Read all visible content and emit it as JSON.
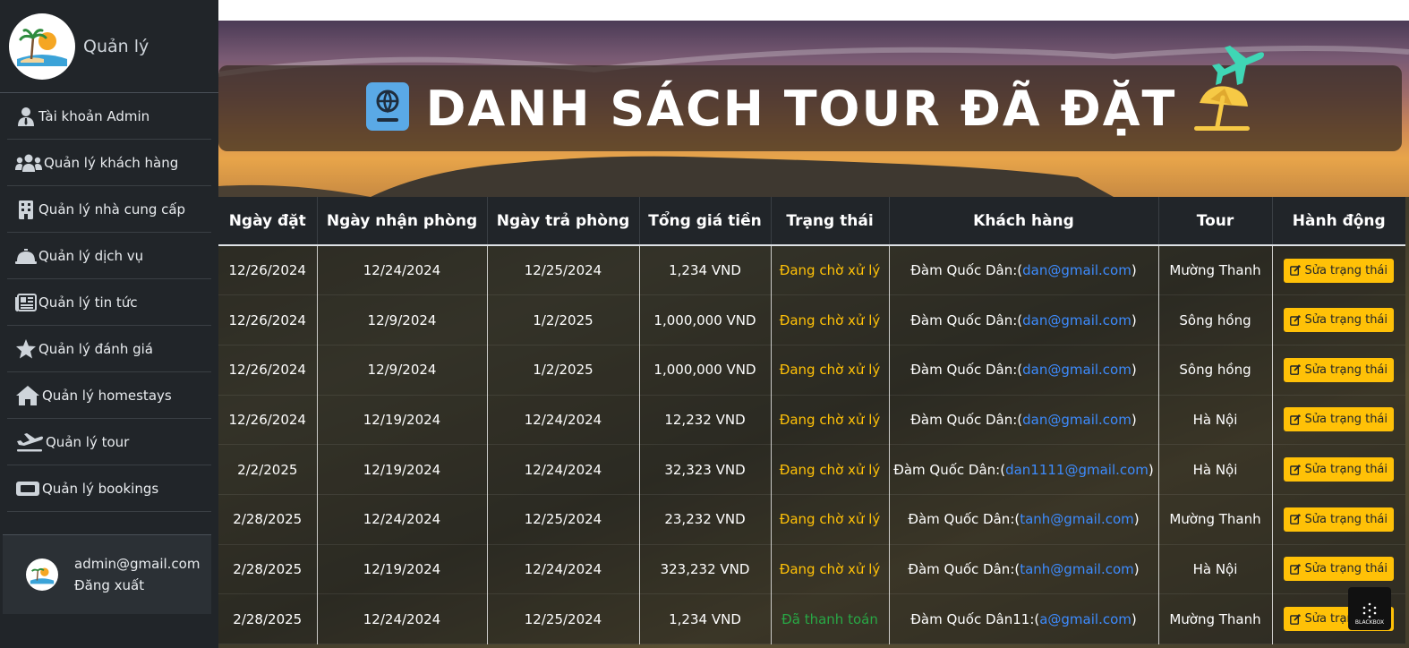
{
  "sidebar": {
    "title": "Quản lý",
    "items": [
      {
        "label": "Tài khoản Admin",
        "icon": "user-tie-icon"
      },
      {
        "label": "Quản lý khách hàng",
        "icon": "users-icon"
      },
      {
        "label": "Quản lý nhà cung cấp",
        "icon": "building-icon"
      },
      {
        "label": "Quản lý dịch vụ",
        "icon": "bell-concierge-icon"
      },
      {
        "label": "Quản lý tin tức",
        "icon": "newspaper-icon"
      },
      {
        "label": "Quản lý đánh giá",
        "icon": "star-icon"
      },
      {
        "label": "Quản lý homestays",
        "icon": "home-icon"
      },
      {
        "label": "Quản lý tour",
        "icon": "plane-departure-icon"
      },
      {
        "label": "Quản lý bookings",
        "icon": "ticket-icon"
      }
    ],
    "user": {
      "email": "admin@gmail.com",
      "logout": "Đăng xuất"
    }
  },
  "header": {
    "title": "DANH SÁCH TOUR ĐÃ ĐẶT"
  },
  "table": {
    "columns": [
      "Ngày đặt",
      "Ngày nhận phòng",
      "Ngày trả phòng",
      "Tổng giá tiền",
      "Trạng thái",
      "Khách hàng",
      "Tour",
      "Hành động"
    ],
    "action_label": "Sửa trạng thái",
    "rows": [
      {
        "booked": "12/26/2024",
        "checkin": "12/24/2024",
        "checkout": "12/25/2024",
        "total": "1,234 VND",
        "status": "Đang chờ xử lý",
        "status_type": "wait",
        "customer": "Đàm Quốc Dân",
        "email": "dan@gmail.com",
        "tour": "Mường Thanh"
      },
      {
        "booked": "12/26/2024",
        "checkin": "12/9/2024",
        "checkout": "1/2/2025",
        "total": "1,000,000 VND",
        "status": "Đang chờ xử lý",
        "status_type": "wait",
        "customer": "Đàm Quốc Dân",
        "email": "dan@gmail.com",
        "tour": "Sông hồng"
      },
      {
        "booked": "12/26/2024",
        "checkin": "12/9/2024",
        "checkout": "1/2/2025",
        "total": "1,000,000 VND",
        "status": "Đang chờ xử lý",
        "status_type": "wait",
        "customer": "Đàm Quốc Dân",
        "email": "dan@gmail.com",
        "tour": "Sông hồng"
      },
      {
        "booked": "12/26/2024",
        "checkin": "12/19/2024",
        "checkout": "12/24/2024",
        "total": "12,232 VND",
        "status": "Đang chờ xử lý",
        "status_type": "wait",
        "customer": "Đàm Quốc Dân",
        "email": "dan@gmail.com",
        "tour": "Hà Nội"
      },
      {
        "booked": "2/2/2025",
        "checkin": "12/19/2024",
        "checkout": "12/24/2024",
        "total": "32,323 VND",
        "status": "Đang chờ xử lý",
        "status_type": "wait",
        "customer": "Đàm Quốc Dân",
        "email": "dan1111@gmail.com",
        "tour": "Hà Nội"
      },
      {
        "booked": "2/28/2025",
        "checkin": "12/24/2024",
        "checkout": "12/25/2024",
        "total": "23,232 VND",
        "status": "Đang chờ xử lý",
        "status_type": "wait",
        "customer": "Đàm Quốc Dân",
        "email": "tanh@gmail.com",
        "tour": "Mường Thanh"
      },
      {
        "booked": "2/28/2025",
        "checkin": "12/19/2024",
        "checkout": "12/24/2024",
        "total": "323,232 VND",
        "status": "Đang chờ xử lý",
        "status_type": "wait",
        "customer": "Đàm Quốc Dân",
        "email": "tanh@gmail.com",
        "tour": "Hà Nội"
      },
      {
        "booked": "2/28/2025",
        "checkin": "12/24/2024",
        "checkout": "12/25/2024",
        "total": "1,234 VND",
        "status": "Đã thanh toán",
        "status_type": "paid",
        "customer": "Đàm Quốc Dân11",
        "email": "a@gmail.com",
        "tour": "Mường Thanh"
      }
    ]
  },
  "colors": {
    "sidebar_bg": "#212529",
    "status_wait": "#ffc107",
    "status_paid": "#28a745",
    "email_link": "#3d8bfd",
    "action_button": "#ffc107"
  },
  "watermark": "BLACKBOX"
}
